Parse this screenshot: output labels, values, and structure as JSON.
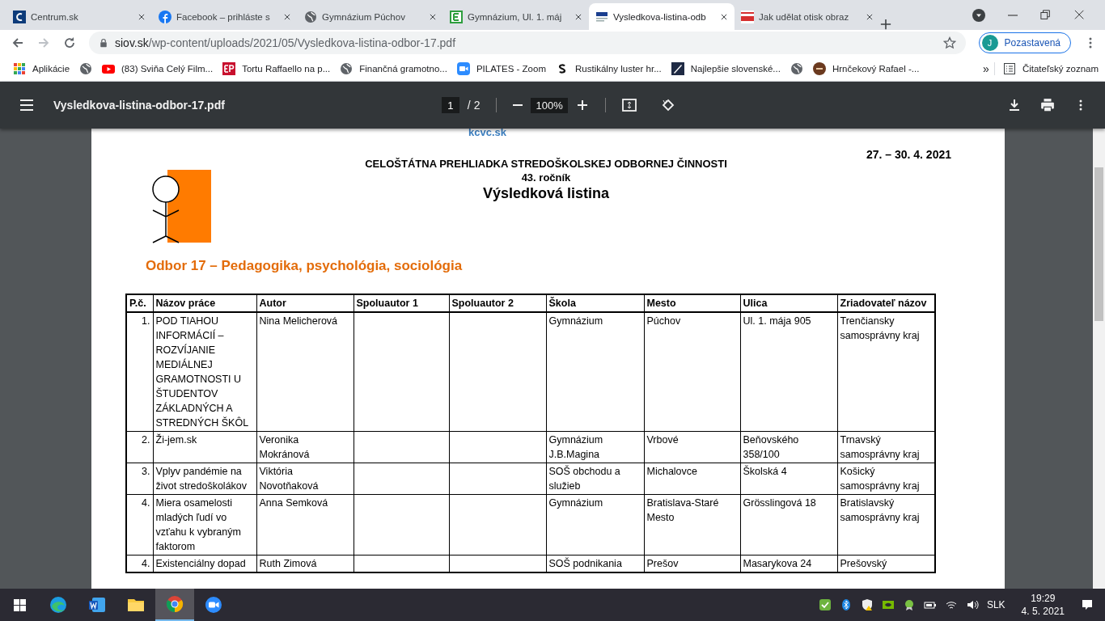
{
  "browser": {
    "tabs": [
      {
        "kind": "centrum",
        "title": "Centrum.sk",
        "selected": false
      },
      {
        "kind": "facebook",
        "title": "Facebook – prihláste s",
        "selected": false
      },
      {
        "kind": "globe",
        "title": "Gymnázium Púchov",
        "selected": false
      },
      {
        "kind": "edupage",
        "title": "Gymnázium, Ul. 1. máj",
        "selected": false
      },
      {
        "kind": "siov",
        "title": "Vysledkova-listina-odb",
        "selected": true
      },
      {
        "kind": "zive",
        "title": "Jak udělat otisk obraz",
        "selected": false
      }
    ],
    "address": {
      "host": "siov.sk",
      "path": "/wp-content/uploads/2021/05/Vysledkova-listina-odbor-17.pdf"
    },
    "profile": {
      "initial": "J",
      "label": "Pozastavená"
    },
    "bookmarks": [
      {
        "kind": "apps",
        "label": "Aplikácie"
      },
      {
        "kind": "globe"
      },
      {
        "kind": "youtube",
        "label": "(83) Sviňa Celý Film..."
      },
      {
        "kind": "ep",
        "label": "Tortu Raffaello na p..."
      },
      {
        "kind": "globe",
        "label": "Finančná gramotno..."
      },
      {
        "kind": "zoom",
        "label": "PILATES - Zoom"
      },
      {
        "kind": "s",
        "label": "Rustikálny luster hr..."
      },
      {
        "kind": "pen",
        "label": "Najlepšie slovenské..."
      },
      {
        "kind": "globe"
      },
      {
        "kind": "round",
        "label": "Hrnčekový Rafael -..."
      }
    ],
    "overflow": "»",
    "reading_list": "Čitateľský zoznam"
  },
  "pdf_viewer": {
    "title": "Vysledkova-listina-odbor-17.pdf",
    "page": "1",
    "pages": "/ 2",
    "zoom": "100%"
  },
  "document": {
    "site": "kcvc.sk",
    "dates": "27. – 30. 4. 2021",
    "heading": "CELOŠTÁTNA PREHLIADKA STREDOŠKOLSKEJ ODBORNEJ ČINNOSTI",
    "edition": "43. ročník",
    "title": "Výsledková listina",
    "section": "Odbor 17 – Pedagogika, psychológia, sociológia",
    "table": {
      "columns": [
        "P.č.",
        "Názov práce",
        "Autor",
        "Spoluautor 1",
        "Spoluautor 2",
        "Škola",
        "Mesto",
        "Ulica",
        "Zriadovateľ názov"
      ],
      "rows": [
        [
          "1.",
          "POD TIAHOU INFORMÁCIÍ – ROZVÍJANIE MEDIÁLNEJ GRAMOTNOSTI U ŠTUDENTOV ZÁKLADNÝCH A STREDNÝCH ŠKÔL",
          "Nina Melicherová",
          "",
          "",
          "Gymnázium",
          "Púchov",
          "Ul. 1. mája 905",
          "Trenčiansky samosprávny kraj"
        ],
        [
          "2.",
          "Ži-jem.sk",
          "Veronika Mokránová",
          "",
          "",
          "Gymnázium J.B.Magina",
          "Vrbové",
          "Beňovského 358/100",
          "Trnavský samosprávny kraj"
        ],
        [
          "3.",
          "Vplyv pandémie na život stredoškolákov",
          "Viktória Novotňaková",
          "",
          "",
          "SOŠ obchodu a služieb",
          "Michalovce",
          "Školská 4",
          "Košický samosprávny kraj"
        ],
        [
          "4.",
          "Miera osamelosti mladých ľudí vo vzťahu k vybraným faktorom",
          "Anna Semková",
          "",
          "",
          "Gymnázium",
          "Bratislava-Staré Mesto",
          "Grösslingová 18",
          "Bratislavský samosprávny kraj"
        ],
        [
          "4.",
          "Existenciálny dopad",
          "Ruth Zimová",
          "",
          "",
          "SOŠ podnikania",
          "Prešov",
          "Masarykova 24",
          "Prešovský"
        ]
      ]
    }
  },
  "taskbar": {
    "apps": [
      {
        "kind": "edge",
        "selected": false
      },
      {
        "kind": "word",
        "selected": false
      },
      {
        "kind": "explorer",
        "selected": false
      },
      {
        "kind": "chrome",
        "selected": true
      },
      {
        "kind": "zoom",
        "selected": false
      }
    ],
    "language": "SLK",
    "time": "19:29",
    "date": "4. 5. 2021"
  }
}
